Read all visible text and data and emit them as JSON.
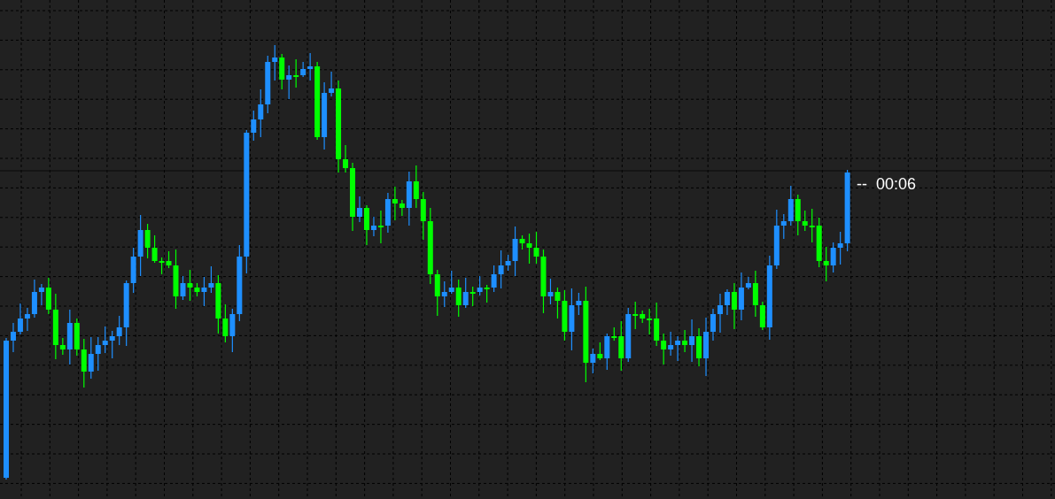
{
  "chart": {
    "countdown": {
      "dashes": "--",
      "time": "00:06"
    }
  }
}
